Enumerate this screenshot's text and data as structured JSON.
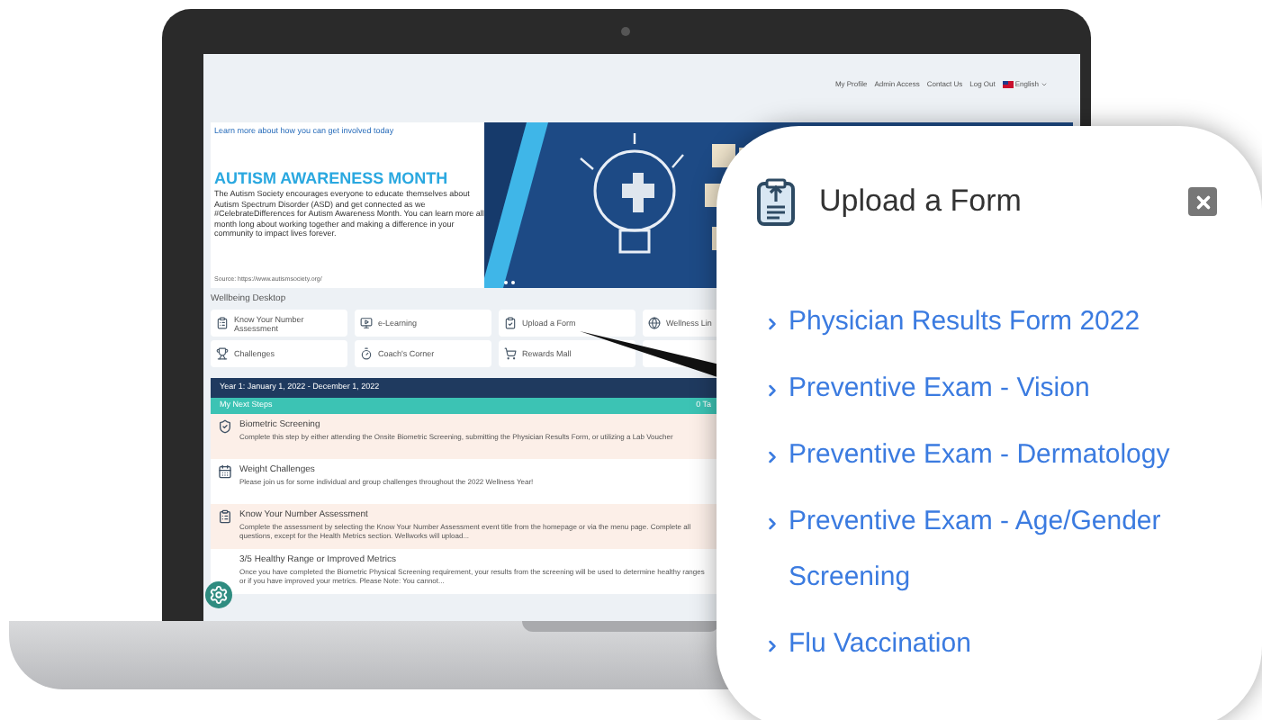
{
  "top_nav": {
    "links": [
      "My Profile",
      "Admin Access",
      "Contact Us",
      "Log Out"
    ],
    "language": "English"
  },
  "banner": {
    "link": "Learn more about how you can get involved today",
    "title": "AUTISM AWARENESS MONTH",
    "body": "The Autism Society encourages everyone to educate themselves about Autism Spectrum Disorder (ASD) and get connected as we #CelebrateDifferences for Autism Awareness Month. You can learn more all month long about working together and making a difference in your community to impact lives forever.",
    "source": "Source: https://www.autismsociety.org/"
  },
  "section_title": "Wellbeing Desktop",
  "tile_rows": [
    [
      "Know Your Number Assessment",
      "e-Learning",
      "Upload a Form",
      "Wellness Lin"
    ],
    [
      "Challenges",
      "Coach's Corner",
      "Rewards Mall"
    ]
  ],
  "program_bar": {
    "period": "Year 1: January 1, 2022 - December 1, 2022"
  },
  "next_steps": {
    "title": "My Next Steps",
    "count": "0 Ta",
    "items": [
      {
        "title": "Biometric Screening",
        "description": "Complete this step by either attending the Onsite Biometric Screening, submitting the Physician Results Form, or utilizing a Lab Voucher"
      },
      {
        "title": "Weight Challenges",
        "description": "Please join us for some individual and group challenges throughout the 2022 Wellness Year!"
      },
      {
        "title": "Know Your Number Assessment",
        "description": "Complete the assessment by selecting the Know Your Number Assessment event title from the homepage or via the menu page. Complete all questions, except for the Health Metrics section. Wellworks will upload..."
      },
      {
        "title": "3/5 Healthy Range or Improved Metrics",
        "description": "Once you have completed the Biometric Physical Screening requirement, your results from the screening will be used to determine healthy ranges or if you have improved your metrics.   Please Note: You cannot..."
      }
    ]
  },
  "popup": {
    "title": "Upload a Form",
    "links": [
      "Physician Results Form 2022",
      "Preventive Exam - Vision",
      "Preventive Exam - Dermatology",
      "Preventive Exam - Age/Gender Screening",
      "Flu Vaccination"
    ]
  }
}
